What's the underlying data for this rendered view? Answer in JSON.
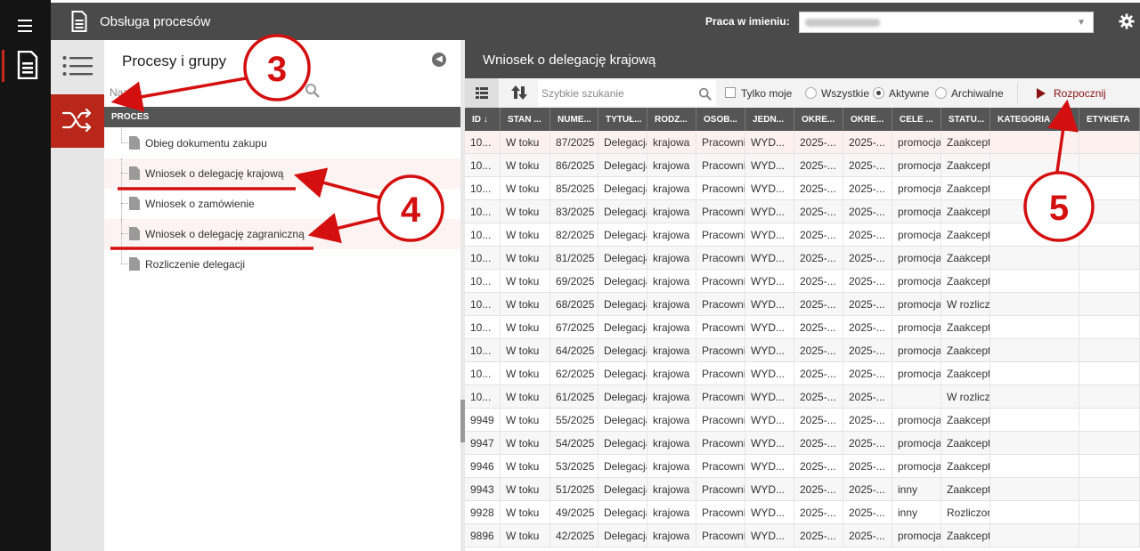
{
  "rail": {
    "menu_icon": "hamburger-icon",
    "doc_icon": "document-icon",
    "accent": "#c4291b"
  },
  "topbar": {
    "app_title": "Obsługa procesów",
    "praca_label": "Praca w imieniu:",
    "praca_icon": "chevron-down-icon",
    "settings_icon": "gear-icon"
  },
  "iconcol": {
    "list_icon": "list-icon",
    "shuffle_icon": "shuffle-icon"
  },
  "process_panel": {
    "title": "Procesy i grupy",
    "name_placeholder": "Nazwa",
    "column_header": "PROCES",
    "items": [
      {
        "label": "Obieg dokumentu zakupu"
      },
      {
        "label": "Wniosek o delegację krajową"
      },
      {
        "label": "Wniosek o zamówienie"
      },
      {
        "label": "Wniosek o delegację zagraniczną"
      },
      {
        "label": "Rozliczenie delegacji"
      }
    ]
  },
  "right_pane": {
    "title": "Wniosek o delegację krajową",
    "toolbar": {
      "search_placeholder": "Szybkie szukanie",
      "only_mine_label": "Tylko moje",
      "filters": [
        "Wszystkie",
        "Aktywne",
        "Archiwalne"
      ],
      "selected_filter": "Aktywne",
      "start_label": "Rozpocznij"
    },
    "columns": [
      "ID ↓",
      "STAN ...",
      "NUME...",
      "TYTUŁ...",
      "RODZ...",
      "OSOB...",
      "JEDN...",
      "OKRE...",
      "OKRE...",
      "CELE ...",
      "STATU...",
      "KATEGORIA",
      "ETYKIETA"
    ],
    "rows": [
      [
        "10...",
        "W toku",
        "87/2025",
        "Delegacja",
        "krajowa",
        "Pracowni",
        "WYD...",
        "2025-...",
        "2025-...",
        "promocja",
        "Zaakcept",
        "",
        ""
      ],
      [
        "10...",
        "W toku",
        "86/2025",
        "Delegacja",
        "krajowa",
        "Pracowni",
        "WYD...",
        "2025-...",
        "2025-...",
        "promocja",
        "Zaakcept",
        "",
        ""
      ],
      [
        "10...",
        "W toku",
        "85/2025",
        "Delegacja",
        "krajowa",
        "Pracowni",
        "WYD...",
        "2025-...",
        "2025-...",
        "promocja",
        "Zaakcept",
        "",
        ""
      ],
      [
        "10...",
        "W toku",
        "83/2025",
        "Delegacja",
        "krajowa",
        "Pracowni",
        "WYD...",
        "2025-...",
        "2025-...",
        "promocja",
        "Zaakcept",
        "",
        ""
      ],
      [
        "10...",
        "W toku",
        "82/2025",
        "Delegacja",
        "krajowa",
        "Pracowni",
        "WYD...",
        "2025-...",
        "2025-...",
        "promocja",
        "Zaakcept",
        "",
        ""
      ],
      [
        "10...",
        "W toku",
        "81/2025",
        "Delegacja",
        "krajowa",
        "Pracowni",
        "WYD...",
        "2025-...",
        "2025-...",
        "promocja",
        "Zaakcept",
        "",
        ""
      ],
      [
        "10...",
        "W toku",
        "69/2025",
        "Delegacja",
        "krajowa",
        "Pracowni",
        "WYD...",
        "2025-...",
        "2025-...",
        "promocja",
        "Zaakcept",
        "",
        ""
      ],
      [
        "10...",
        "W toku",
        "68/2025",
        "Delegacja",
        "krajowa",
        "Pracowni",
        "WYD...",
        "2025-...",
        "2025-...",
        "promocja",
        "W rozlicz",
        "",
        ""
      ],
      [
        "10...",
        "W toku",
        "67/2025",
        "Delegacja",
        "krajowa",
        "Pracowni",
        "WYD...",
        "2025-...",
        "2025-...",
        "promocja",
        "Zaakcept",
        "",
        ""
      ],
      [
        "10...",
        "W toku",
        "64/2025",
        "Delegacja",
        "krajowa",
        "Pracowni",
        "WYD...",
        "2025-...",
        "2025-...",
        "promocja",
        "Zaakcept",
        "",
        ""
      ],
      [
        "10...",
        "W toku",
        "62/2025",
        "Delegacja",
        "krajowa",
        "Pracowni",
        "WYD...",
        "2025-...",
        "2025-...",
        "promocja",
        "Zaakcept",
        "",
        ""
      ],
      [
        "10...",
        "W toku",
        "61/2025",
        "Delegacja",
        "krajowa",
        "Pracowni",
        "WYD...",
        "2025-...",
        "2025-...",
        "",
        "W rozlicz",
        "",
        ""
      ],
      [
        "9949",
        "W toku",
        "55/2025",
        "Delegacja",
        "krajowa",
        "Pracowni",
        "WYD...",
        "2025-...",
        "2025-...",
        "promocja",
        "Zaakcept",
        "",
        ""
      ],
      [
        "9947",
        "W toku",
        "54/2025",
        "Delegacja",
        "krajowa",
        "Pracowni",
        "WYD...",
        "2025-...",
        "2025-...",
        "promocja",
        "Zaakcept",
        "",
        ""
      ],
      [
        "9946",
        "W toku",
        "53/2025",
        "Delegacja",
        "krajowa",
        "Pracowni",
        "WYD...",
        "2025-...",
        "2025-...",
        "promocja",
        "Zaakcept",
        "",
        ""
      ],
      [
        "9943",
        "W toku",
        "51/2025",
        "Delegacja",
        "krajowa",
        "Pracowni",
        "WYD...",
        "2025-...",
        "2025-...",
        "inny",
        "Zaakcept",
        "",
        ""
      ],
      [
        "9928",
        "W toku",
        "49/2025",
        "Delegacja",
        "krajowa",
        "Pracowni",
        "WYD...",
        "2025-...",
        "2025-...",
        "inny",
        "Rozliczor",
        "",
        ""
      ],
      [
        "9896",
        "W toku",
        "42/2025",
        "Delegacja",
        "krajowa",
        "Pracowni",
        "WYD...",
        "2025-...",
        "2025-...",
        "promocja",
        "Zaakcept",
        "",
        ""
      ]
    ]
  },
  "annotations": {
    "marker_3": "3",
    "marker_4": "4",
    "marker_5": "5",
    "color": "#d40f0f"
  }
}
